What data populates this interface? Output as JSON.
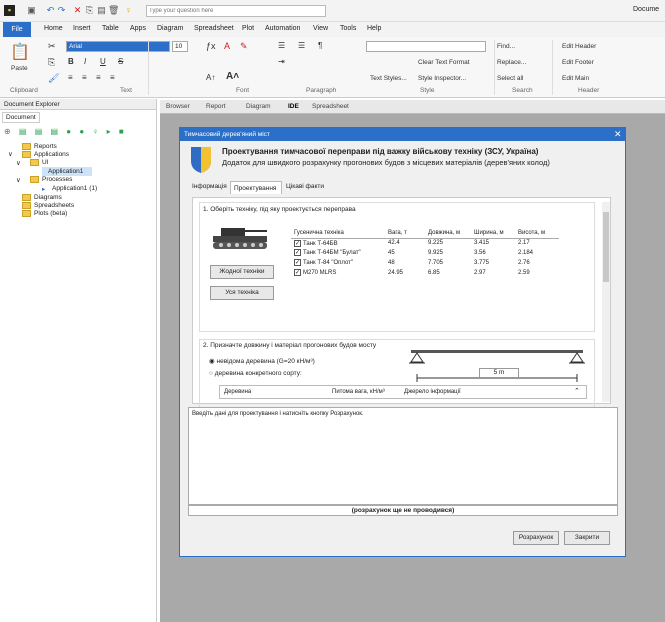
{
  "qat": {
    "search_placeholder": "Type your question here",
    "doc_label": "Docume"
  },
  "menu": {
    "file": "File",
    "items": [
      "Home",
      "Insert",
      "Table",
      "Apps",
      "Diagram",
      "Spreadsheet",
      "Plot",
      "Automation",
      "View",
      "Tools",
      "Help"
    ]
  },
  "ribbon": {
    "paste": "Paste",
    "font_name": "Arial",
    "font_size": "10",
    "groups": {
      "clipboard": "Clipboard",
      "text": "Text",
      "font": "Font",
      "paragraph": "Paragraph",
      "style": "Style",
      "search": "Search",
      "header": "Header"
    },
    "clear_format": "Clear Text Format",
    "text_styles": "Text Styles...",
    "style_inspector": "Style Inspector...",
    "find": "Find...",
    "replace": "Replace...",
    "select_all": "Select all",
    "edit_header": "Edit Header",
    "edit_footer": "Edit Footer",
    "edit_main": "Edit Main"
  },
  "explorer": {
    "title": "Document Explorer",
    "tab": "Document",
    "items": {
      "reports": "Reports",
      "applications": "Applications",
      "ui": "UI",
      "application1": "Application1",
      "processes": "Processes",
      "proc_app": "Application1 (1)",
      "diagrams": "Diagrams",
      "spreadsheets": "Spreadsheets",
      "plots": "Plots (beta)"
    }
  },
  "doc_tabs": [
    "Browser",
    "Report",
    "Diagram",
    "IDE",
    "Spreadsheet"
  ],
  "dialog": {
    "title": "Тимчасовий дерев'яний міст",
    "heading": "Проектування тимчасової переправи під важку військову техніку (ЗСУ, Україна)",
    "subheading": "Додаток для швидкого розрахунку прогонових будов з місцевих матеріалів (дерев'яних колод)",
    "tabs": [
      "Інформація",
      "Проектування",
      "Цікаві факти"
    ],
    "section1": "1. Оберіть техніку, під яку проектується переправа",
    "btn_none": "Жодної техніки",
    "btn_all": "Уся техніка",
    "table_headers": [
      "Гусенична техніка",
      "Вага, т",
      "Довжина, м",
      "Ширина, м",
      "Висота, м"
    ],
    "rows": [
      [
        "Танк Т-64БВ",
        "42.4",
        "9.225",
        "3.415",
        "2.17"
      ],
      [
        "Танк Т-64БМ \"Булат\"",
        "45",
        "9.925",
        "3.56",
        "2.184"
      ],
      [
        "Танк Т-84 \"Оплот\"",
        "48",
        "7.705",
        "3.775",
        "2.76"
      ],
      [
        "M270 MLRS",
        "24.95",
        "6.85",
        "2.97",
        "2.59"
      ]
    ],
    "section2": "2. Призначте довжину і матеріал прогонових будов мосту",
    "radio1": "невідома деревина (G=20 кН/м³)",
    "radio2": "деревина конкретного сорту:",
    "span_label": "5 m",
    "wood_headers": [
      "Деревина",
      "Питома вага, кН/м³",
      "Джерело інформації"
    ],
    "log_text": "Введіть дані для проектування і натисніть кнопку Розрахунок.",
    "status_text": "(розрахунок ще не проводився)",
    "btn_calc": "Розрахунок",
    "btn_close": "Закрити",
    "colors": {
      "titlebar": "#2b6fc8",
      "shield_blue": "#2f6cc4",
      "shield_yellow": "#f2c230"
    }
  }
}
